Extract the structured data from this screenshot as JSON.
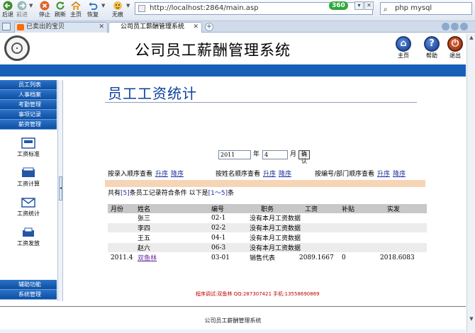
{
  "browser": {
    "nav_buttons": [
      {
        "label": "后退",
        "icon": "back-arrow-icon"
      },
      {
        "label": "前进",
        "icon": "forward-arrow-icon"
      },
      {
        "label": "停止",
        "icon": "stop-icon"
      },
      {
        "label": "刷新",
        "icon": "refresh-icon"
      },
      {
        "label": "主页",
        "icon": "home-icon"
      },
      {
        "label": "恢复",
        "icon": "undo-icon"
      },
      {
        "label": "无痕",
        "icon": "incognito-icon"
      }
    ],
    "url": "http://localhost:2864/main.asp",
    "badge": "360",
    "search_value": "php mysql",
    "tabs": [
      {
        "label": "已卖出的宝贝",
        "active": false
      },
      {
        "label": "公司员工薪酬管理系统",
        "active": true
      }
    ],
    "new_tab_glyph": "+",
    "colors": {
      "chrome": "#dfe7f2",
      "badge": "#2fa83a"
    }
  },
  "header": {
    "title": "公司员工薪酬管理系统",
    "buttons": [
      {
        "label": "主页",
        "glyph": "⌂",
        "icon": "home-icon"
      },
      {
        "label": "帮助",
        "glyph": "?",
        "icon": "help-icon"
      },
      {
        "label": "退出",
        "glyph": "⏻",
        "icon": "exit-icon"
      }
    ],
    "colors": {
      "band": "#1660b8",
      "title_accent": "#0b3f9a"
    }
  },
  "sidebar": {
    "top_items": [
      "员工列表",
      "人事档案",
      "考勤管理",
      "事项记录",
      "薪资管理"
    ],
    "sub_items": [
      {
        "label": "工资标准",
        "icon": "salary-standard-icon"
      },
      {
        "label": "工资计算",
        "icon": "salary-calc-icon"
      },
      {
        "label": "工资统计",
        "icon": "salary-stats-icon"
      },
      {
        "label": "工资发放",
        "icon": "salary-payout-icon"
      }
    ],
    "bottom_items": [
      "辅助功能",
      "系统管理"
    ]
  },
  "main": {
    "title": "员工工资统计",
    "year_value": "2011",
    "year_unit": "年",
    "month_value": "4",
    "month_unit": "月",
    "confirm_label": "确认",
    "sort_groups": [
      {
        "label": "按录入顺序查看",
        "asc": "升序",
        "desc": "降序"
      },
      {
        "label": "按姓名顺序查看",
        "asc": "升序",
        "desc": "降序"
      },
      {
        "label": "按编号/部门顺序查看",
        "asc": "升序",
        "desc": "降序"
      }
    ],
    "summary": {
      "prefix": "共有",
      "count": "[5]",
      "middle": "条员工记录符合条件 以下是",
      "range": "[1～5]",
      "suffix": "条"
    },
    "table": {
      "columns": [
        "月份",
        "姓名",
        "编号",
        "职务",
        "工资",
        "补贴",
        "实发"
      ],
      "rows": [
        {
          "month": "",
          "name": "张三",
          "id": "02-1",
          "position": "没有本月工资数据",
          "salary": "",
          "bonus": "",
          "net": ""
        },
        {
          "month": "",
          "name": "李四",
          "id": "02-2",
          "position": "没有本月工资数据",
          "salary": "",
          "bonus": "",
          "net": ""
        },
        {
          "month": "",
          "name": "王五",
          "id": "04-1",
          "position": "没有本月工资数据",
          "salary": "",
          "bonus": "",
          "net": ""
        },
        {
          "month": "",
          "name": "赵六",
          "id": "06-3",
          "position": "没有本月工资数据",
          "salary": "",
          "bonus": "",
          "net": ""
        },
        {
          "month": "2011.4",
          "name": "双鱼林",
          "id": "03-01",
          "position": "销售代表",
          "salary": "2089.1667",
          "bonus": "0",
          "net": "2018.6083"
        }
      ]
    },
    "credits": "程序调试:双鱼林 QQ:287307421 手机:13558690869"
  },
  "footer": {
    "text": "公司员工薪酬管理系统"
  }
}
